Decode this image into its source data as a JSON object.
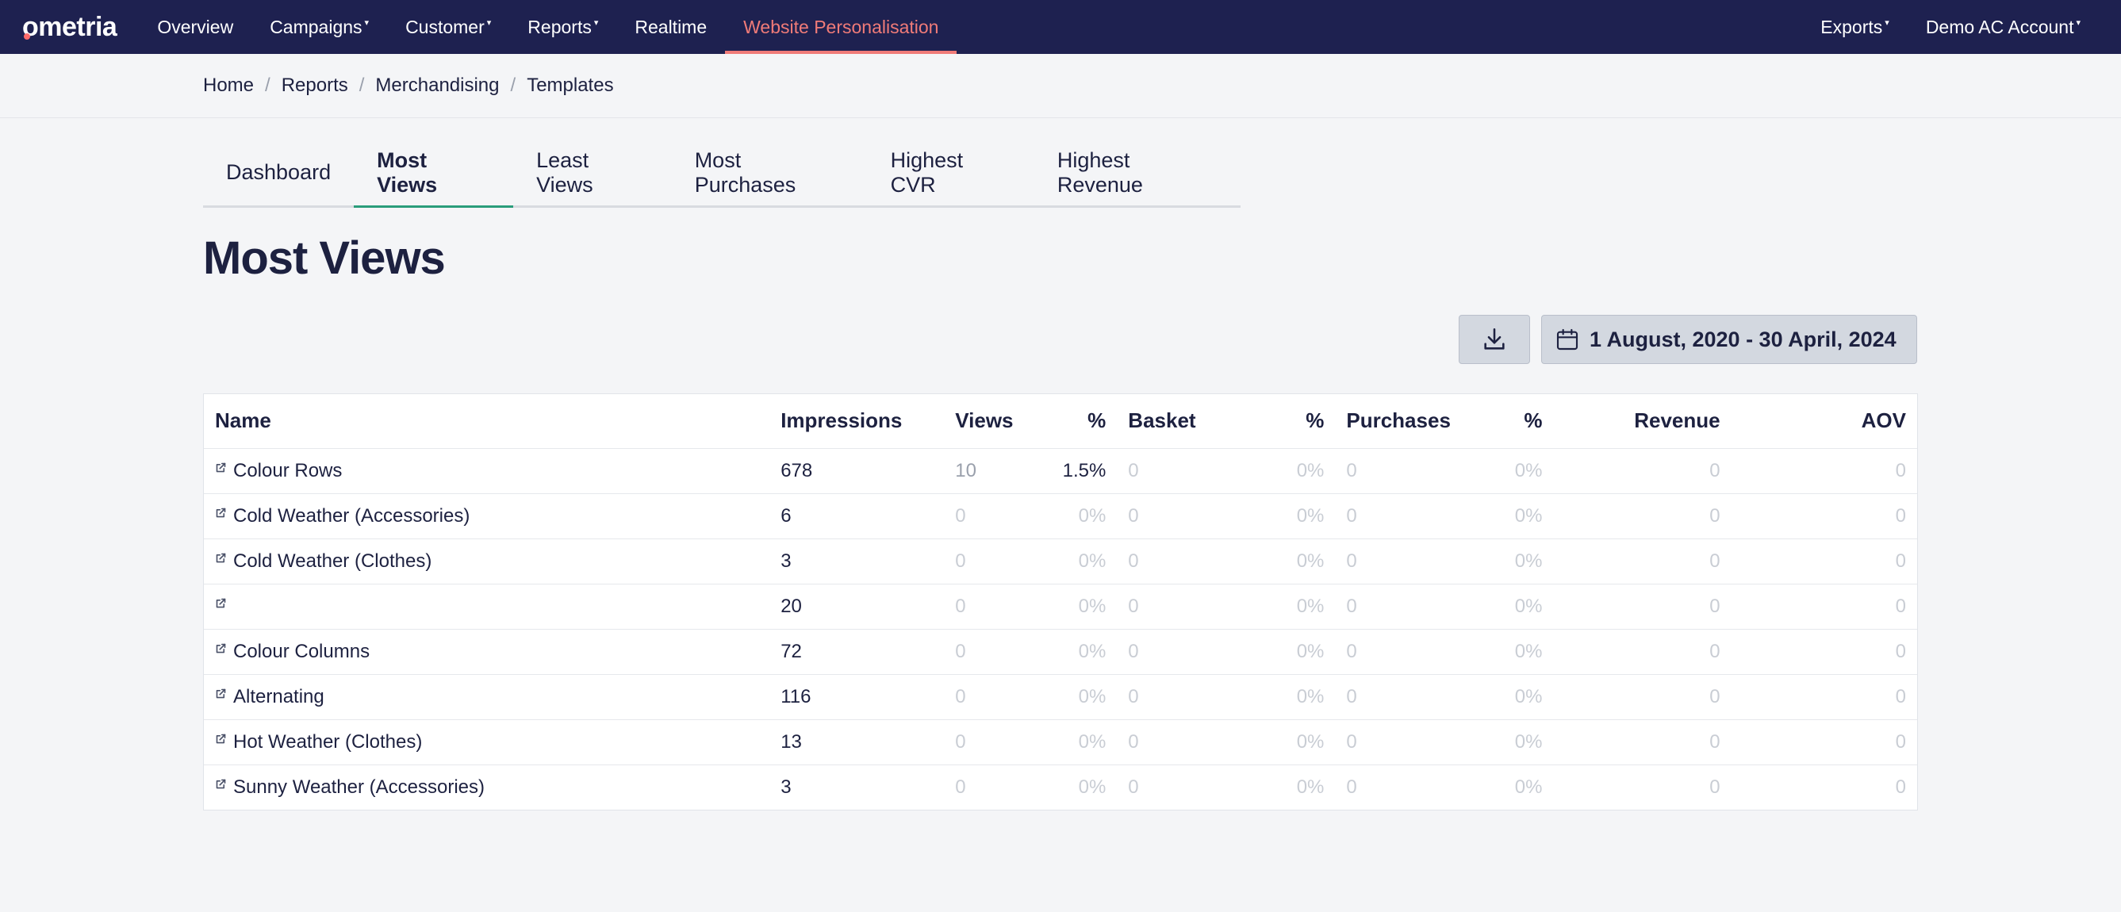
{
  "nav": {
    "logo": "ometria",
    "items": [
      {
        "label": "Overview",
        "caret": ""
      },
      {
        "label": "Campaigns",
        "caret": "▾"
      },
      {
        "label": "Customer",
        "caret": "▾"
      },
      {
        "label": "Reports",
        "caret": "▾"
      },
      {
        "label": "Realtime",
        "caret": ""
      },
      {
        "label": "Website Personalisation",
        "caret": ""
      }
    ],
    "right": [
      {
        "label": "Exports",
        "caret": "▾"
      },
      {
        "label": "Demo AC Account",
        "caret": "▾"
      }
    ],
    "accent_color": "#f07b78",
    "bg_color": "#1e2150"
  },
  "breadcrumb": [
    "Home",
    "Reports",
    "Merchandising",
    "Templates"
  ],
  "breadcrumb_sep": "/",
  "tabs": [
    "Dashboard",
    "Most Views",
    "Least Views",
    "Most Purchases",
    "Highest CVR",
    "Highest Revenue"
  ],
  "active_tab": "Most Views",
  "page_title": "Most Views",
  "toolbar": {
    "download_icon": "download-icon",
    "date_icon": "calendar-icon",
    "date_range": "1 August, 2020 - 30 April, 2024"
  },
  "table": {
    "headers": [
      "Name",
      "Impressions",
      "Views",
      "%",
      "Basket",
      "%",
      "Purchases",
      "%",
      "Revenue",
      "AOV"
    ],
    "rows": [
      [
        "Colour Rows",
        "678",
        "10",
        "1.5%",
        "0",
        "0%",
        "0",
        "0%",
        "0",
        "0"
      ],
      [
        "Cold Weather (Accessories)",
        "6",
        "0",
        "0%",
        "0",
        "0%",
        "0",
        "0%",
        "0",
        "0"
      ],
      [
        "Cold Weather (Clothes)",
        "3",
        "0",
        "0%",
        "0",
        "0%",
        "0",
        "0%",
        "0",
        "0"
      ],
      [
        "",
        "20",
        "0",
        "0%",
        "0",
        "0%",
        "0",
        "0%",
        "0",
        "0"
      ],
      [
        "Colour Columns",
        "72",
        "0",
        "0%",
        "0",
        "0%",
        "0",
        "0%",
        "0",
        "0"
      ],
      [
        "Alternating",
        "116",
        "0",
        "0%",
        "0",
        "0%",
        "0",
        "0%",
        "0",
        "0"
      ],
      [
        "Hot Weather (Clothes)",
        "13",
        "0",
        "0%",
        "0",
        "0%",
        "0",
        "0%",
        "0",
        "0"
      ],
      [
        "Sunny Weather (Accessories)",
        "3",
        "0",
        "0%",
        "0",
        "0%",
        "0",
        "0%",
        "0",
        "0"
      ]
    ]
  }
}
